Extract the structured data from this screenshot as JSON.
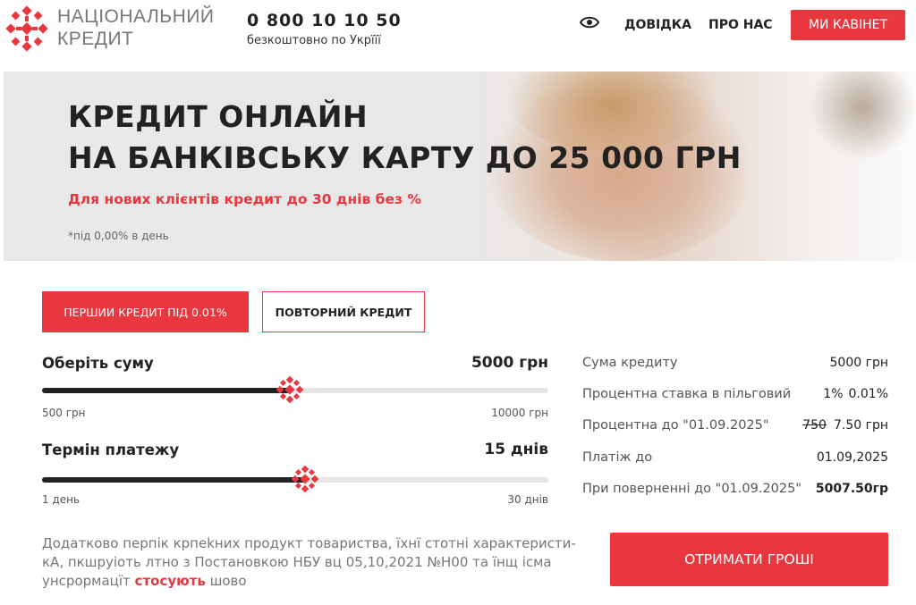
{
  "header": {
    "brand_line1": "НАЦІОНАЛЬНИЙ",
    "brand_line2": "КРЕДИТ",
    "phone": "0 800 10 10 50",
    "phone_note": "безкоштовно по Укрїїї",
    "nav_help": "ДОВІДКА",
    "nav_about": "ПРО НАС",
    "cabinet_label": "МИ КАВІНЕТ",
    "icons": [
      "logo-ornament",
      "eye-icon"
    ]
  },
  "hero": {
    "title_line1": "КРЕДИТ ОНЛАЙН",
    "title_line2": "НА БАНКІВСЬКУ КАРТУ ДО 25 000 ГРН",
    "promo": "Для нових клієнтів кредит до 30 днів без %",
    "note": "*під 0,00% в день"
  },
  "tabs": {
    "first": "ПЕРШИИ КРЕДИТ ПІД 0.01%",
    "repeat": "ПОВТОРНИЙ КРЕДИТ",
    "active": "first"
  },
  "calculator": {
    "amount": {
      "label": "Оберіть суму",
      "value": "5000 грн",
      "min_label": "500 грн",
      "max_label": "10000 грн",
      "level": 0.49
    },
    "term": {
      "label": "Термін платежу",
      "value": "15 днів",
      "min_label": "1 день",
      "max_label": "30 днів",
      "level": 0.52
    }
  },
  "summary": {
    "rows": [
      {
        "label": "Сума кредиту",
        "value": "5000 грн"
      },
      {
        "label": "Процентна ставка в пільговий",
        "value_old": "1%",
        "value": "0.01%"
      },
      {
        "label": "Процентна до \"01.09.2025\"",
        "value_old": "750",
        "value": "7.50 грн"
      },
      {
        "label": "Платіж до",
        "value": "01.09,2025"
      },
      {
        "label": "При поверненні до \"01.09.2025\"",
        "value": "5007.50гр"
      }
    ]
  },
  "disclaimer": {
    "line1": "Додатково перпік крпеkних продукт товариства, їхнї стотні характеристи-",
    "line2": "кА, пкшpуіоть лтно з Постановкою НБУ вц 05,10,2021 №Н00 та їнщ ісма",
    "line3_start": "унcpормацїт ",
    "link": "стосують",
    "line3_end": " шово"
  },
  "cta": {
    "label": "ОТРИМАТИ ГРОШІ"
  },
  "colors": {
    "accent": "#e8373e",
    "text": "#222222",
    "muted": "#777777",
    "track": "#e6e6e6"
  }
}
